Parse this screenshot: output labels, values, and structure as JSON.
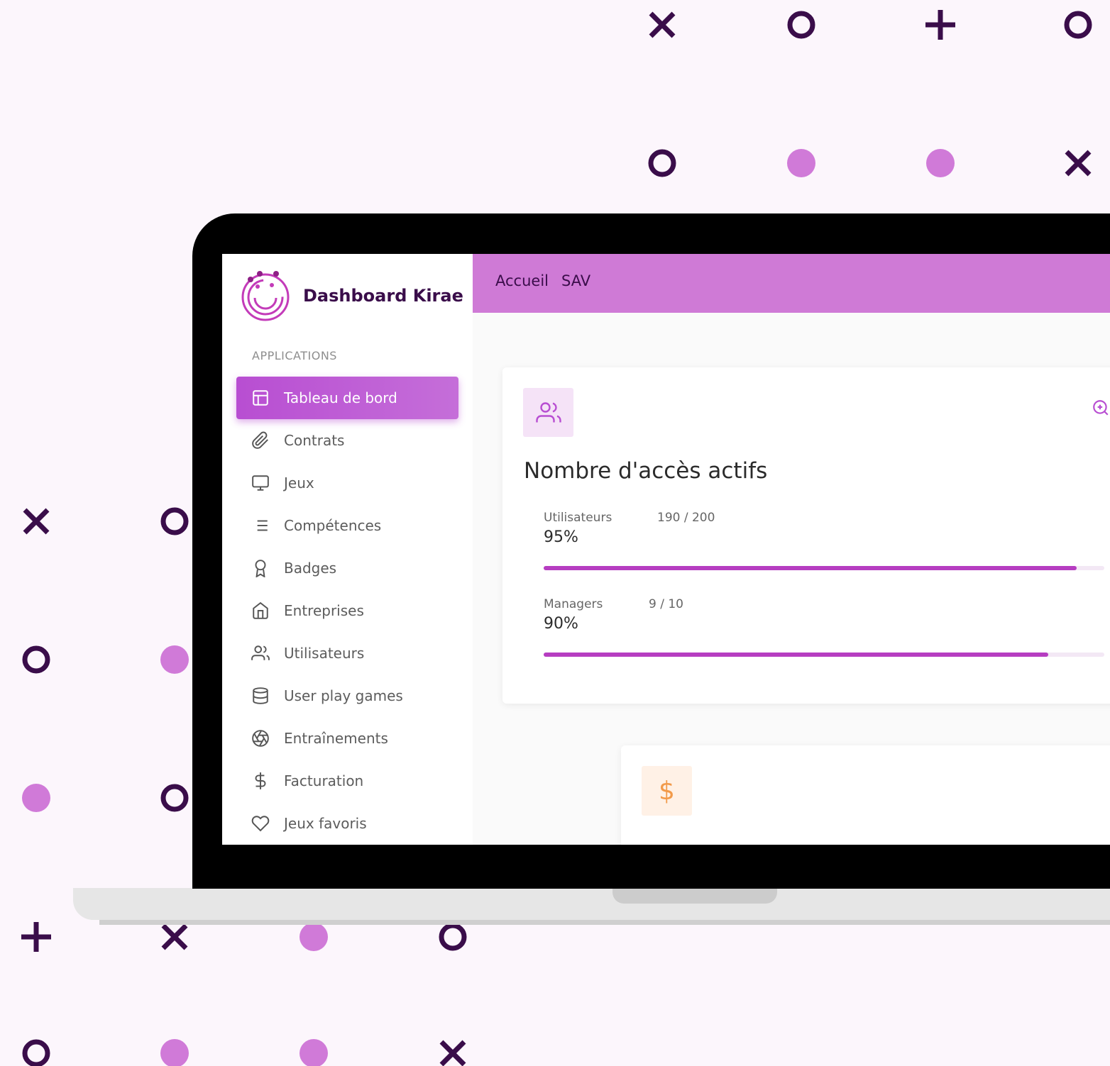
{
  "brand": {
    "title": "Dashboard Kirae",
    "colors": {
      "primary": "#b84ed2",
      "topbar": "#cf7ad6",
      "dark": "#3a0d4a",
      "accent_orange": "#f29a4a"
    }
  },
  "sidebar": {
    "section_label": "APPLICATIONS",
    "items": [
      {
        "label": "Tableau de bord",
        "icon": "layout-icon",
        "active": true
      },
      {
        "label": "Contrats",
        "icon": "paperclip-icon",
        "active": false
      },
      {
        "label": "Jeux",
        "icon": "monitor-icon",
        "active": false
      },
      {
        "label": "Compétences",
        "icon": "list-icon",
        "active": false
      },
      {
        "label": "Badges",
        "icon": "award-icon",
        "active": false
      },
      {
        "label": "Entreprises",
        "icon": "home-icon",
        "active": false
      },
      {
        "label": "Utilisateurs",
        "icon": "users-icon",
        "active": false
      },
      {
        "label": "User play games",
        "icon": "database-icon",
        "active": false
      },
      {
        "label": "Entraînements",
        "icon": "aperture-icon",
        "active": false
      },
      {
        "label": "Facturation",
        "icon": "dollar-icon",
        "active": false
      },
      {
        "label": "Jeux favoris",
        "icon": "heart-icon",
        "active": false
      }
    ]
  },
  "topbar": {
    "links": [
      "Accueil",
      "SAV"
    ]
  },
  "access_card": {
    "icon": "users-icon",
    "title": "Nombre d'accès actifs",
    "stats": [
      {
        "label": "Utilisateurs",
        "ratio": "190 / 200",
        "percent": "95%",
        "fill": 0.95
      },
      {
        "label": "Managers",
        "ratio": "9 / 10",
        "percent": "90%",
        "fill": 0.9
      }
    ]
  },
  "billing_card": {
    "icon": "$"
  }
}
